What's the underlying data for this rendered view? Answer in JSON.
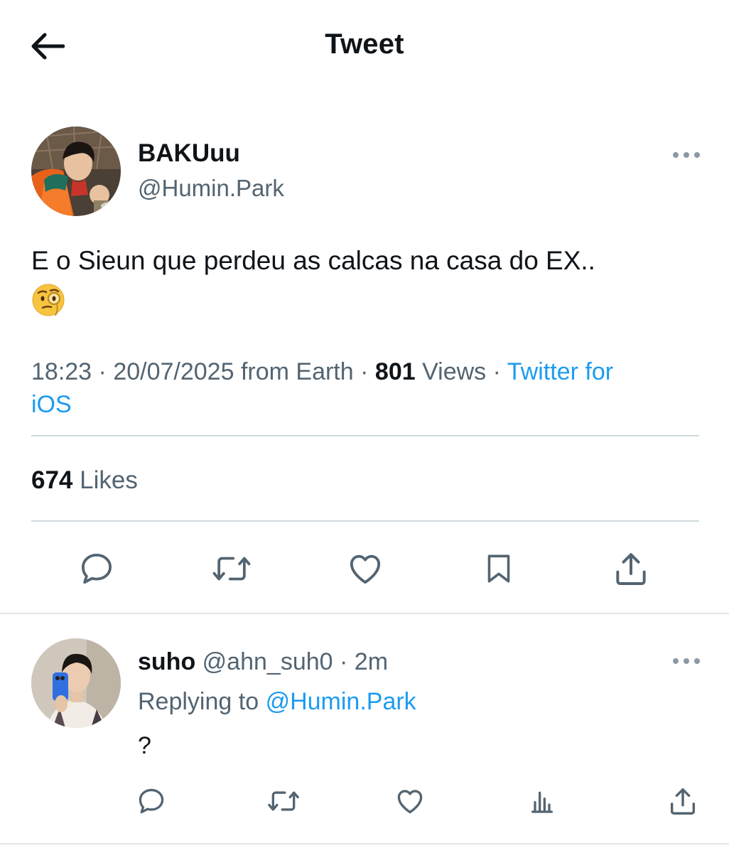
{
  "header": {
    "title": "Tweet",
    "back_icon": "arrow-left-icon"
  },
  "tweet": {
    "author_name": "BAKUuu",
    "author_handle": "@Humin.Park",
    "text": "E o Sieun que perdeu as calcas na casa do EX..",
    "emoji": "face-with-monocle",
    "time": "18:23",
    "date": "20/07/2025",
    "location": "from Earth",
    "views_count": "801",
    "views_label": "Views",
    "client_line1": "Twitter for",
    "client_line2": "iOS",
    "likes_count": "674",
    "likes_label": "Likes",
    "actions": [
      "reply-icon",
      "retweet-icon",
      "like-icon",
      "bookmark-icon",
      "share-icon"
    ]
  },
  "reply": {
    "author_name": "suho",
    "author_handle": "@ahn_suh0",
    "separator": "·",
    "time": "2m",
    "replying_label": "Replying to",
    "replying_to": "@Humin.Park",
    "text": "?",
    "actions": [
      "reply-icon",
      "retweet-icon",
      "like-icon",
      "analytics-icon",
      "share-icon"
    ]
  },
  "colors": {
    "text_primary": "#0f1419",
    "text_secondary": "#536471",
    "link": "#1d9bf0",
    "divider": "#cfd9de"
  }
}
